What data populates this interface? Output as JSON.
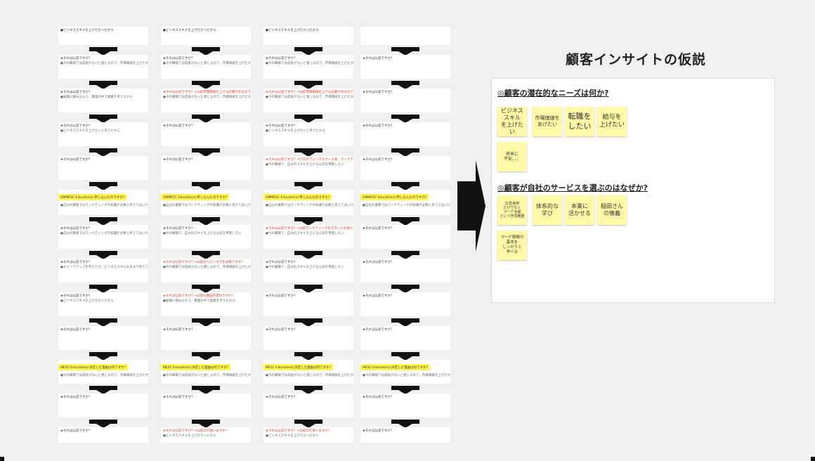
{
  "slide_title": "顧客インサイトの仮説",
  "board": {
    "q1": "◎顧客の潜在的なニーズは何か?",
    "q2": "◎顧客が自社のサービスを選ぶのはなぜか?",
    "needs_notes": [
      "ビジネス\nスキル\nを上げたい",
      "市場価値を\nあげたい",
      "転職を\nしたい",
      "給与を\n上げたい",
      "将来に\n不安．．．"
    ],
    "reason_notes": [
      "広告運用\nだけでなく\nマーケ全般\nという学習範囲",
      "体系的な\n学び",
      "本業に\n活かせる",
      "稲田さん\nの懐義",
      "マーケ戦略の\n基本を\nしっかりと\n学べる"
    ]
  },
  "grid": {
    "q": "★それは以前ですか？",
    "q_red_suffix": "★それは以前ですか？⇒以前市場価値を上げる必要があるのですか?",
    "q_red_b": "★それは以前ですか？⇒プログラミングスクール等、マーケティングのスクールを比較検討されたのですか?",
    "q_red_c": "★それは以前ですか？⇒以前マーケティングのスクールを探されたのですか?",
    "q_red_d": "★それは以前ですか？⇒以前なぜ迷いますか？",
    "q_red_e": "★それは以前ですか？⇒以前からビジネスを必要ですか?",
    "q_red_f": "★それは以前ですか？⇒以前も勉強不足のですか?",
    "a1": "●ビジネススキルを上げたかったから",
    "a2": "●今の職場では成長がないと感じるので、市場価値を上げたかったから",
    "a3": "●転職に踏み込もう、無理の中で副業を考えたから",
    "a4": "●ビジネススキルを上げたいと考えたから",
    "a5": "●今の職場で、自分のスキルを上げる以前を用意したい",
    "a6": "●自分の業務ではマーケティングの知識が必要と考えてはいけない",
    "a7": "●キャリアアップを考えたが、ビジネススキルもあまり考えていない",
    "hl1": "GMMESC Educationに申し込んだのですか?",
    "hl2": "MESC Educationに決定した理由は何ですか?"
  }
}
